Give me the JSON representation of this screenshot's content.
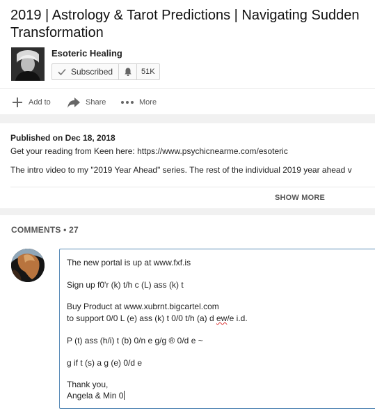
{
  "video": {
    "title": "2019 | Astrology & Tarot Predictions | Navigating Sudden Transformation"
  },
  "channel": {
    "name": "Esoteric Healing",
    "subscribed_label": "Subscribed",
    "subscriber_count": "51K"
  },
  "actions": {
    "add_to": "Add to",
    "share": "Share",
    "more": "More"
  },
  "description": {
    "published": "Published on Dec 18, 2018",
    "line1": "Get your reading from Keen here: https://www.psychicnearme.com/esoteric",
    "line2": "The intro video to my \"2019 Year Ahead\" series. The rest of the individual 2019 year ahead v",
    "show_more": "SHOW MORE"
  },
  "comments": {
    "header": "COMMENTS • 27",
    "draft": {
      "l1": "The new portal is up at www.fxf.is",
      "l2": "Sign up f0'r (k) t/h c (L) ass (k) t",
      "l3": "Buy Product at www.xubrnt.bigcartel.com",
      "l4a": "to support 0/0 L (e) ass (k) t 0/0 t/h (a) d ",
      "l4b": "ew",
      "l4c": "/e i.d.",
      "l5": "P (t) ass (h/i) t (b) 0/n e g/g ® 0/d e ~",
      "l6": "g if t (s) a g (e) 0/d e",
      "l7": "Thank you,",
      "l8": "Angela & Min 0"
    }
  },
  "colors": {
    "focus_border": "#5b8db8",
    "spellcheck": "#dd3333"
  },
  "icons": [
    "check-icon",
    "bell-icon",
    "add-icon",
    "share-icon",
    "more-dots-icon"
  ]
}
